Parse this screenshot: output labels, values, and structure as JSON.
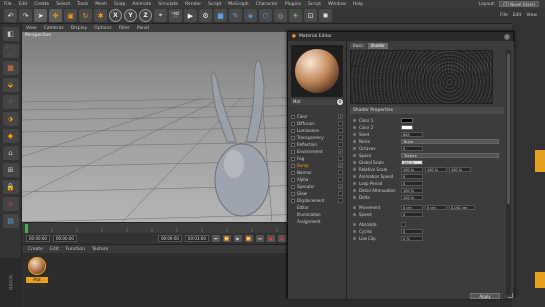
{
  "app": {
    "menu": [
      "File",
      "Edit",
      "Create",
      "Select",
      "Tools",
      "Mesh",
      "Snap",
      "Animate",
      "Simulate",
      "Render",
      "Script",
      "MoGraph",
      "Character",
      "Plugins",
      "Script",
      "Window",
      "Help"
    ],
    "layout_label": "Layout:",
    "layout_value": "(T) Novel (User)",
    "topright_menu": [
      "File",
      "Edit",
      "View"
    ],
    "toolbar_xyz": [
      "X",
      "Y",
      "Z"
    ]
  },
  "viewport": {
    "menu": [
      "View",
      "Cameras",
      "Display",
      "Options",
      "Filter",
      "Panel"
    ],
    "label": "Perspective"
  },
  "transport": {
    "start_frame": "00:00:00",
    "current_frame": "00:00:00",
    "end_frame": "00:09:00",
    "end_frame2": "00:03:00"
  },
  "material_manager": {
    "menu": [
      "Create",
      "Edit",
      "Function",
      "Texture"
    ],
    "material_name": "Mat"
  },
  "material_editor": {
    "title": "Material Editor",
    "close_glyph": "×",
    "material_name": "Mat",
    "gear_glyph": "⚙",
    "channels": [
      {
        "label": "Color",
        "checked": true,
        "check_glyph": "✓"
      },
      {
        "label": "Diffusion",
        "checked": false,
        "check_glyph": ""
      },
      {
        "label": "Luminance",
        "checked": false,
        "check_glyph": ""
      },
      {
        "label": "Transparency",
        "checked": false,
        "check_glyph": ""
      },
      {
        "label": "Reflection",
        "checked": false,
        "check_glyph": ""
      },
      {
        "label": "Environment",
        "checked": true,
        "check_glyph": "✓"
      },
      {
        "label": "Fog",
        "checked": false,
        "check_glyph": ""
      },
      {
        "label": "Bump",
        "checked": true,
        "check_glyph": "✓",
        "selected": true
      },
      {
        "label": "Normal",
        "checked": false,
        "check_glyph": ""
      },
      {
        "label": "Alpha",
        "checked": false,
        "check_glyph": ""
      },
      {
        "label": "Specular",
        "checked": true,
        "check_glyph": "✓"
      },
      {
        "label": "Glow",
        "checked": false,
        "check_glyph": ""
      },
      {
        "label": "Displacement",
        "checked": false,
        "check_glyph": ""
      }
    ],
    "plain_items": [
      "Editor",
      "Illumination",
      "Assignment"
    ],
    "tabs": [
      "Basic",
      "Shader"
    ],
    "active_tab": "Shader",
    "section_header": "Shader Properties",
    "props": {
      "color1_label": "Color 1",
      "color1": "#000000",
      "color2_label": "Color 2",
      "color2": "#ffffff",
      "seed_label": "Seed",
      "seed": "665",
      "noise_label": "Noise",
      "noise": "Buya",
      "octaves_label": "Octaves",
      "octaves": "5",
      "space_label": "Space",
      "space": "Texture",
      "global_scale_label": "Global Scale",
      "global_scale": "100 %",
      "relative_scale_label": "Relative Scale",
      "relative_scale": [
        "100 %",
        "100 %",
        "100 %"
      ],
      "anim_speed_label": "Animation Speed",
      "anim_speed": "0",
      "loop_period_label": "Loop Period",
      "loop_period": "0",
      "detail_atten_label": "Detail Attenuation",
      "detail_atten": "100 %",
      "delta_label": "Delta",
      "delta": "100 %",
      "movement_label": "Movement",
      "movement": [
        "0 cm",
        "0 cm",
        "0.001 cm"
      ],
      "speed_label": "Speed",
      "speed": "0",
      "absolute_label": "Absolute",
      "cycles_label": "Cycles",
      "cycles": "0",
      "low_clip_label": "Low Clip",
      "low_clip": "0 %"
    },
    "apply_label": "Apply"
  },
  "status": {
    "brightness_label": "Brightness",
    "brightness": "100 %"
  },
  "colors": {
    "accent": "#f39c12"
  }
}
